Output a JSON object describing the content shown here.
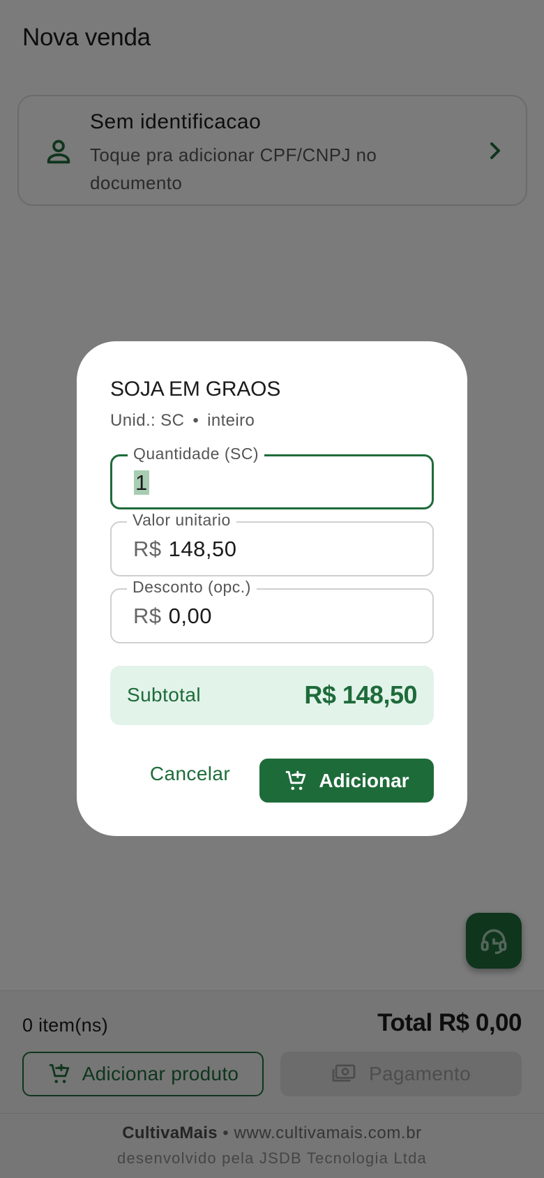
{
  "header": {
    "title": "Nova venda"
  },
  "customer": {
    "title": "Sem identificacao",
    "subtitle": "Toque pra adicionar CPF/CNPJ no documento"
  },
  "footer_bar": {
    "items_count": "0 item(ns)",
    "total": "Total R$ 0,00",
    "add_product_label": "Adicionar produto",
    "payment_label": "Pagamento"
  },
  "credits": {
    "brand": "CultivaMais",
    "site": "www.cultivamais.com.br",
    "developer": "desenvolvido pela JSDB Tecnologia Ltda"
  },
  "dialog": {
    "product_name": "SOJA EM GRAOS",
    "unit_label": "Unid.: SC",
    "separator": "•",
    "quantity_mode": "inteiro",
    "quantity": {
      "label": "Quantidade (SC)",
      "value": "1"
    },
    "unit_price": {
      "label": "Valor unitario",
      "prefix": "R$",
      "value": "148,50"
    },
    "discount": {
      "label": "Desconto (opc.)",
      "prefix": "R$",
      "value": "0,00"
    },
    "subtotal": {
      "label": "Subtotal",
      "value": "R$ 148,50"
    },
    "cancel_label": "Cancelar",
    "confirm_label": "Adicionar"
  },
  "icons": {
    "customer": "person-icon",
    "customer_action": "chevron-right-icon",
    "support": "headset-icon",
    "add_product": "cart-plus-icon",
    "payment": "cash-icon",
    "confirm": "cart-plus-icon"
  },
  "colors": {
    "primary": "#1e6b3a",
    "subtotal_bg": "#e2f3ea",
    "disabled_bg": "#d9d9d9"
  }
}
